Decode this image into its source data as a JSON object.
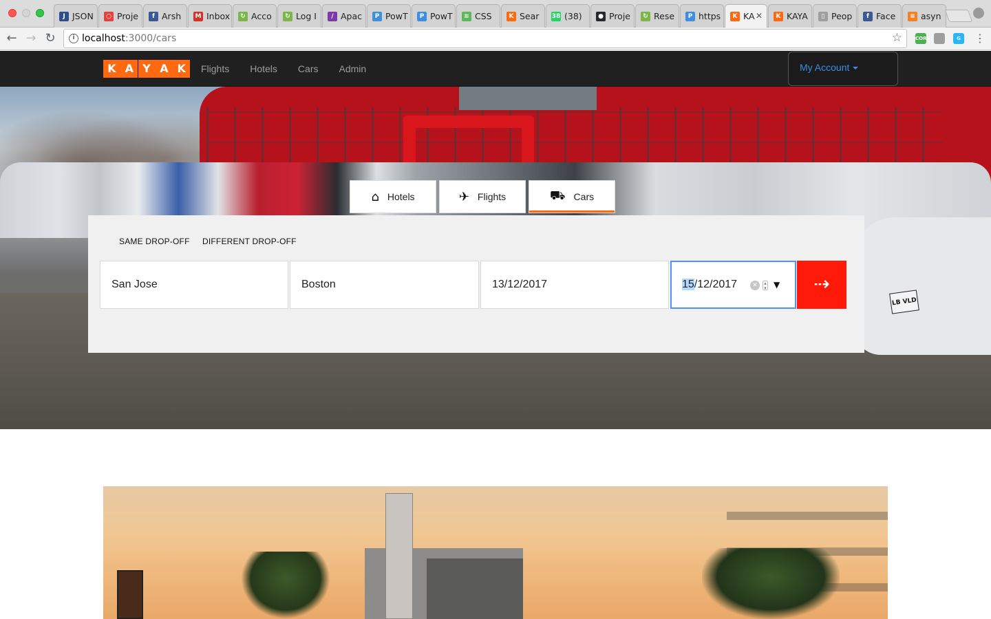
{
  "browser": {
    "tabs": [
      {
        "title": "JSON",
        "icon_color": "#2d4f8b",
        "icon_letter": "J"
      },
      {
        "title": "Proje",
        "icon_color": "#e8403b",
        "icon_letter": "○"
      },
      {
        "title": "Arsh",
        "icon_color": "#3b5998",
        "icon_letter": "f"
      },
      {
        "title": "Inbox",
        "icon_color": "#d93025",
        "icon_letter": "M"
      },
      {
        "title": "Acco",
        "icon_color": "#7ab648",
        "icon_letter": "↻"
      },
      {
        "title": "Log I",
        "icon_color": "#7ab648",
        "icon_letter": "↻"
      },
      {
        "title": "Apac",
        "icon_color": "#7c3aa8",
        "icon_letter": "/"
      },
      {
        "title": "PowT",
        "icon_color": "#3f8fe0",
        "icon_letter": "P"
      },
      {
        "title": "PowT",
        "icon_color": "#3f8fe0",
        "icon_letter": "P"
      },
      {
        "title": "CSS",
        "icon_color": "#5cb85c",
        "icon_letter": "≋"
      },
      {
        "title": "Sear",
        "icon_color": "#ff690f",
        "icon_letter": "K"
      },
      {
        "title": "(38)",
        "icon_color": "#25d366",
        "icon_letter": "38"
      },
      {
        "title": "Proje",
        "icon_color": "#24292e",
        "icon_letter": "●"
      },
      {
        "title": "Rese",
        "icon_color": "#7ab648",
        "icon_letter": "↻"
      },
      {
        "title": "https",
        "icon_color": "#3f8fe0",
        "icon_letter": "P"
      },
      {
        "title": "KA",
        "icon_color": "#ff690f",
        "icon_letter": "K",
        "active": true
      },
      {
        "title": "KAYA",
        "icon_color": "#ff690f",
        "icon_letter": "K"
      },
      {
        "title": "Peop",
        "icon_color": "#9e9e9e",
        "icon_letter": "▯"
      },
      {
        "title": "Face",
        "icon_color": "#3b5998",
        "icon_letter": "f"
      },
      {
        "title": "asyn",
        "icon_color": "#f48024",
        "icon_letter": "≡"
      }
    ],
    "url_host": "localhost",
    "url_path": ":3000/cars",
    "extensions": [
      {
        "name": "cors-extension-icon",
        "color": "#4caf50",
        "label": "CORS"
      },
      {
        "name": "profile-extension-icon",
        "color": "#9e9e9e",
        "label": ""
      },
      {
        "name": "grammar-extension-icon",
        "color": "#29b6f6",
        "label": "G"
      }
    ]
  },
  "app": {
    "logo_letters": [
      "K",
      "A",
      "Y",
      "A",
      "K"
    ],
    "nav": [
      "Flights",
      "Hotels",
      "Cars",
      "Admin"
    ],
    "account_label": "My Account",
    "accent": "#ff690f",
    "link_color": "#3a8ee6"
  },
  "search": {
    "tabs": [
      {
        "label": "Hotels",
        "icon": "hotel-bed-icon"
      },
      {
        "label": "Flights",
        "icon": "airplane-icon"
      },
      {
        "label": "Cars",
        "icon": "car-icon"
      }
    ],
    "modes": [
      "SAME DROP-OFF",
      "DIFFERENT DROP-OFF"
    ],
    "pickup_location": "San Jose",
    "dropoff_location": "Boston",
    "pickup_date": "13/12/2017",
    "dropoff_date_selected": "15",
    "dropoff_date_rest": "/12/2017",
    "submit_color": "#ff1a0a"
  },
  "hero": {
    "plate_text": "LB VLD"
  }
}
